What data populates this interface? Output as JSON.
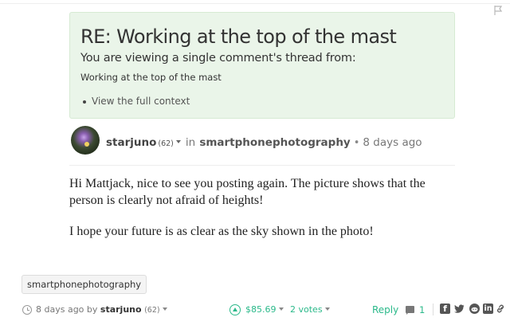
{
  "context": {
    "title": "RE: Working at the top of the mast",
    "subtitle": "You are viewing a single comment's thread from:",
    "parent_title": "Working at the top of the mast",
    "link_label": "View the full context"
  },
  "post": {
    "author": "starjuno",
    "reputation": "(62)",
    "in_label": "in",
    "community": "smartphonephotography",
    "separator": "•",
    "time": "8 days ago",
    "body": [
      "Hi Mattjack, nice to see you posting again. The picture shows that the person is clearly not afraid of heights!",
      "I hope your future is as clear as the sky shown in the photo!"
    ]
  },
  "tags": [
    "smartphonephotography"
  ],
  "footer": {
    "time_text": "8 days ago by",
    "author": "starjuno",
    "reputation": "(62)",
    "payout": "$85.69",
    "votes": "2 votes",
    "reply_label": "Reply",
    "replies_count": "1"
  },
  "icons": {
    "flag": "flag-icon",
    "clock": "clock-icon",
    "upvote": "upvote-icon",
    "replies": "comments-icon",
    "share": [
      "facebook-icon",
      "twitter-icon",
      "reddit-icon",
      "linkedin-icon",
      "link-icon"
    ]
  },
  "colors": {
    "accent": "#2bb98a",
    "context_background": "#eaf5e9"
  }
}
